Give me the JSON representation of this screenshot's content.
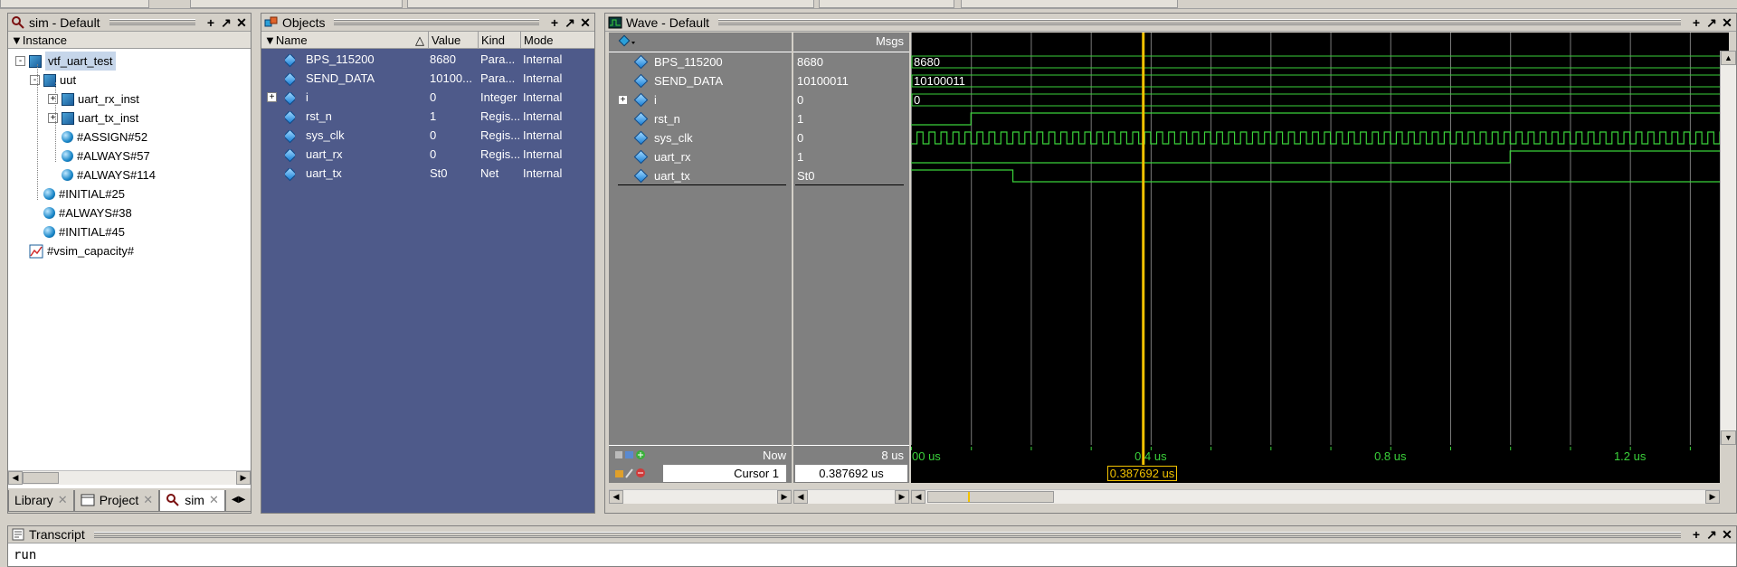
{
  "sim_panel": {
    "title": "sim - Default",
    "column": "Instance",
    "tree": [
      {
        "label": "vtf_uart_test",
        "kind": "module",
        "depth": 0,
        "expander": "-",
        "selected": true
      },
      {
        "label": "uut",
        "kind": "module",
        "depth": 1,
        "expander": "-"
      },
      {
        "label": "uart_rx_inst",
        "kind": "module",
        "depth": 2,
        "expander": "+"
      },
      {
        "label": "uart_tx_inst",
        "kind": "module",
        "depth": 2,
        "expander": "+"
      },
      {
        "label": "#ASSIGN#52",
        "kind": "process",
        "depth": 2
      },
      {
        "label": "#ALWAYS#57",
        "kind": "process",
        "depth": 2
      },
      {
        "label": "#ALWAYS#114",
        "kind": "process",
        "depth": 2
      },
      {
        "label": "#INITIAL#25",
        "kind": "process",
        "depth": 1
      },
      {
        "label": "#ALWAYS#38",
        "kind": "process",
        "depth": 1
      },
      {
        "label": "#INITIAL#45",
        "kind": "process",
        "depth": 1
      },
      {
        "label": "#vsim_capacity#",
        "kind": "capacity",
        "depth": 0
      }
    ],
    "tabs": [
      {
        "label": "Library",
        "active": false
      },
      {
        "label": "Project",
        "active": false
      },
      {
        "label": "sim",
        "active": true
      }
    ]
  },
  "objects_panel": {
    "title": "Objects",
    "columns": {
      "name": "Name",
      "value": "Value",
      "kind": "Kind",
      "mode": "Mode"
    },
    "rows": [
      {
        "name": "BPS_115200",
        "value": "8680",
        "kind": "Para...",
        "mode": "Internal"
      },
      {
        "name": "SEND_DATA",
        "value": "10100...",
        "kind": "Para...",
        "mode": "Internal"
      },
      {
        "name": "i",
        "value": "0",
        "kind": "Integer",
        "mode": "Internal",
        "expander": "+"
      },
      {
        "name": "rst_n",
        "value": "1",
        "kind": "Regis...",
        "mode": "Internal"
      },
      {
        "name": "sys_clk",
        "value": "0",
        "kind": "Regis...",
        "mode": "Internal"
      },
      {
        "name": "uart_rx",
        "value": "0",
        "kind": "Regis...",
        "mode": "Internal"
      },
      {
        "name": "uart_tx",
        "value": "St0",
        "kind": "Net",
        "mode": "Internal"
      }
    ]
  },
  "wave_panel": {
    "title": "Wave - Default",
    "msgs_label": "Msgs",
    "signals": [
      {
        "name": "BPS_115200",
        "value": "8680",
        "bus_text": "8680",
        "type": "bus"
      },
      {
        "name": "SEND_DATA",
        "value": "10100011",
        "bus_text": "10100011",
        "type": "bus"
      },
      {
        "name": "i",
        "value": "0",
        "bus_text": "0",
        "type": "bus",
        "expander": "+"
      },
      {
        "name": "rst_n",
        "value": "1",
        "type": "bit"
      },
      {
        "name": "sys_clk",
        "value": "0",
        "type": "clock"
      },
      {
        "name": "uart_rx",
        "value": "1",
        "type": "bit"
      },
      {
        "name": "uart_tx",
        "value": "St0",
        "type": "bit"
      }
    ],
    "now_label": "Now",
    "now_value": "8 us",
    "cursor_label": "Cursor 1",
    "cursor_value": "0.387692 us",
    "cursor_tag": "0.387692 us",
    "timeline_labels": [
      "00 us",
      "0.4 us",
      "0.8 us",
      "1.2 us"
    ],
    "timeline_range_us": [
      0.0,
      1.35
    ],
    "cursor_time_us": 0.387692,
    "rst_n_rise_us": 0.1,
    "uart_tx_fall_us": 0.17,
    "uart_rx_rise_us": 1.0,
    "clk_period_us": 0.02,
    "colors": {
      "wave": "#3ad13a",
      "cursor": "#f2c200",
      "bus_text": "#ffffff"
    }
  },
  "transcript": {
    "title": "Transcript",
    "text": "run"
  },
  "colors": {
    "objects_bg": "#4e5a8a",
    "selection": "#c6d6ea",
    "chrome": "#d4d0c8"
  }
}
